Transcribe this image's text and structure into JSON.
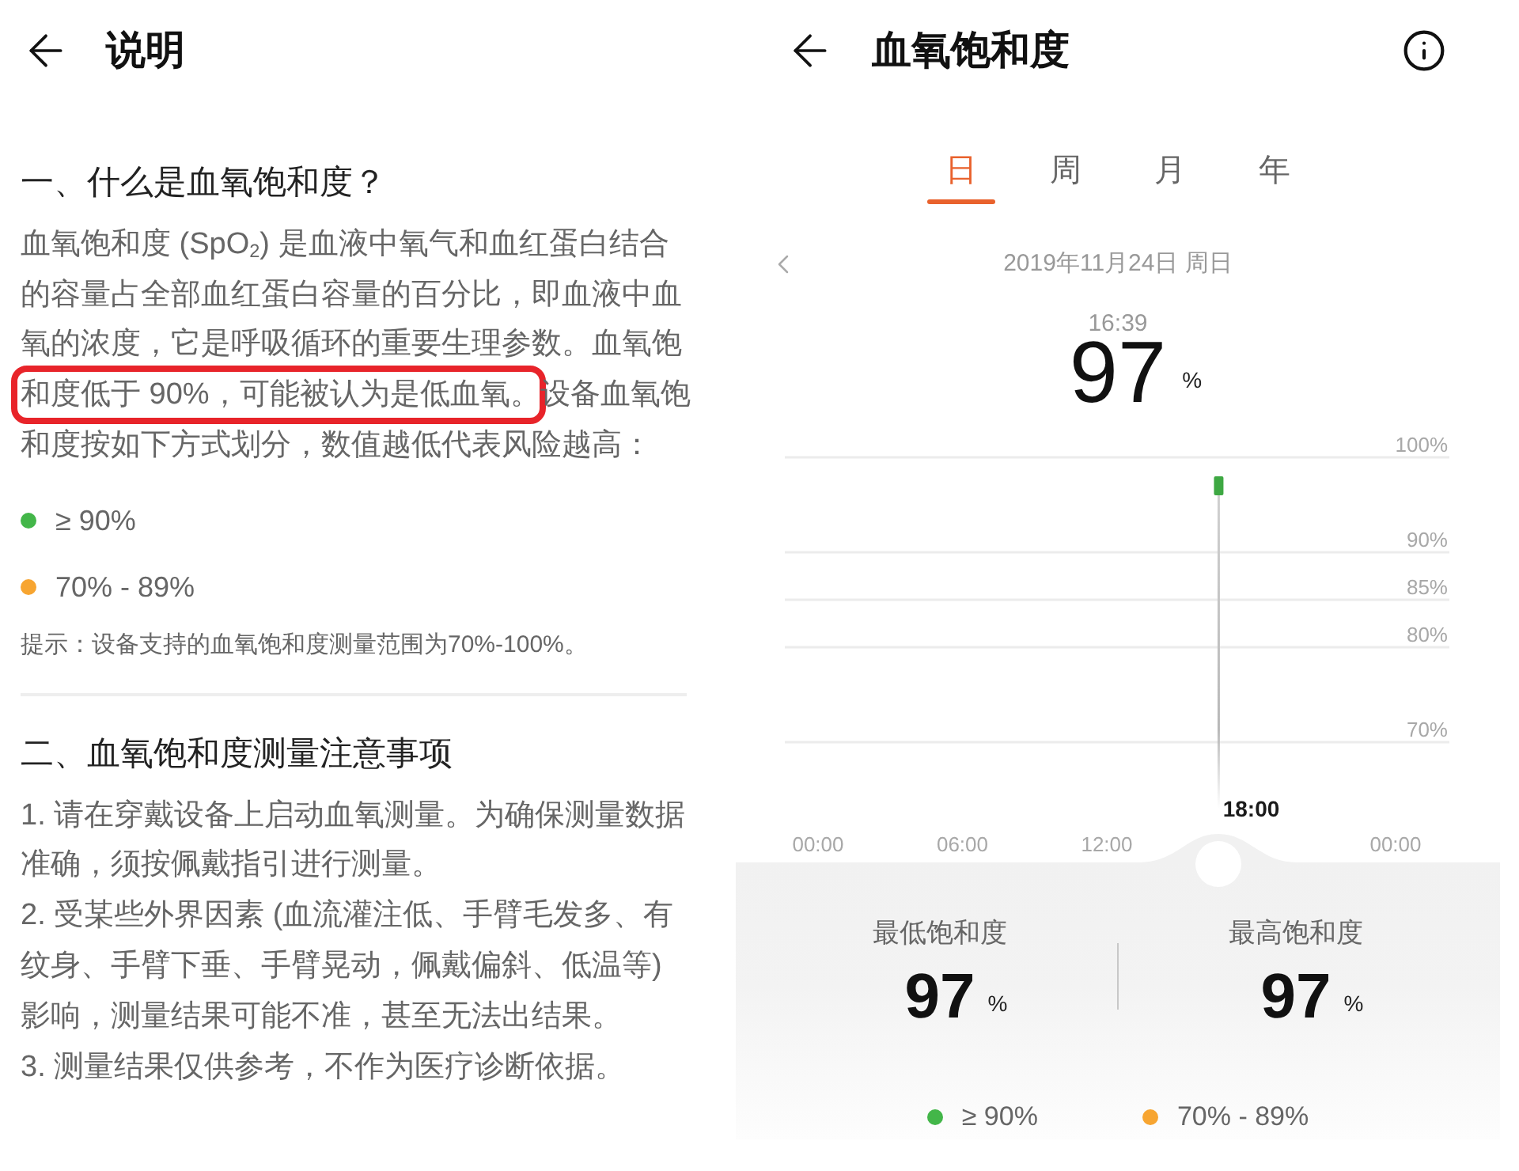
{
  "explanation": {
    "title": "说明",
    "sections": [
      {
        "heading": "一、什么是血氧饱和度？",
        "paragraph": [
          {
            "text": "血氧饱和度 (SpO$_{2}$) 是血液中氧气和血红蛋白结合的容量占全部血红蛋白容量的百分比，即血液中血氧的浓度，它是呼吸循环的重要生理参数。血氧饱",
            "highlighted": false
          },
          {
            "text": "和度低于 90%，可能被认为是低血氧。",
            "highlighted": true
          },
          {
            "text": "设备血氧饱和度按如下方式划分，数值越低代表风险越高：",
            "highlighted": false
          }
        ],
        "legend": [
          {
            "label": "≥ 90%",
            "color": "#43b649"
          },
          {
            "label": "70% - 89%",
            "color": "#f7a531"
          }
        ],
        "tip": "提示：设备支持的血氧饱和度测量范围为70%-100%。"
      },
      {
        "heading": "二、血氧饱和度测量注意事项",
        "items": [
          "1. 请在穿戴设备上启动血氧测量。为确保测量数据准确，须按佩戴指引进行测量。",
          "2. 受某些外界因素 (血流灌注低、手臂毛发多、有纹身、手臂下垂、手臂晃动，佩戴偏斜、低温等) 影响，测量结果可能不准，甚至无法出结果。",
          "3. 测量结果仅供参考，不作为医疗诊断依据。"
        ]
      }
    ]
  },
  "spo2": {
    "title": "血氧饱和度",
    "tabs": [
      {
        "label": "日",
        "selected": true
      },
      {
        "label": "周",
        "selected": false
      },
      {
        "label": "月",
        "selected": false
      },
      {
        "label": "年",
        "selected": false
      }
    ],
    "date": "2019年11月24日 周日",
    "reading": {
      "time": "16:39",
      "value": "97",
      "unit": "%"
    },
    "chart": {
      "scrubber_label": "18:00",
      "chart_data": {
        "type": "scatter",
        "x": [
          16.65
        ],
        "series": [
          {
            "color": "#3ea843",
            "values": [
              97
            ]
          }
        ],
        "xlim": [
          0,
          24
        ],
        "ylim": [
          70,
          100
        ],
        "grid": true,
        "xticks": [
          {
            "value": 0,
            "label": "00:00"
          },
          {
            "value": 6,
            "label": "06:00"
          },
          {
            "value": 12,
            "label": "12:00"
          },
          {
            "value": 24,
            "label": "00:00"
          }
        ],
        "yticks": [
          {
            "value": 100,
            "label": "100%"
          },
          {
            "value": 90,
            "label": "90%"
          },
          {
            "value": 85,
            "label": "85%"
          },
          {
            "value": 80,
            "label": "80%"
          },
          {
            "value": 70,
            "label": "70%"
          }
        ],
        "ref_lines": [
          {
            "axis": "x",
            "value": 16.65
          }
        ]
      }
    },
    "summary": [
      {
        "label": "最低饱和度",
        "value": "97",
        "unit": "%"
      },
      {
        "label": "最高饱和度",
        "value": "97",
        "unit": "%"
      }
    ],
    "legend": [
      {
        "label": "≥ 90%",
        "color": "#43b649"
      },
      {
        "label": "70% - 89%",
        "color": "#f7a531"
      }
    ]
  }
}
